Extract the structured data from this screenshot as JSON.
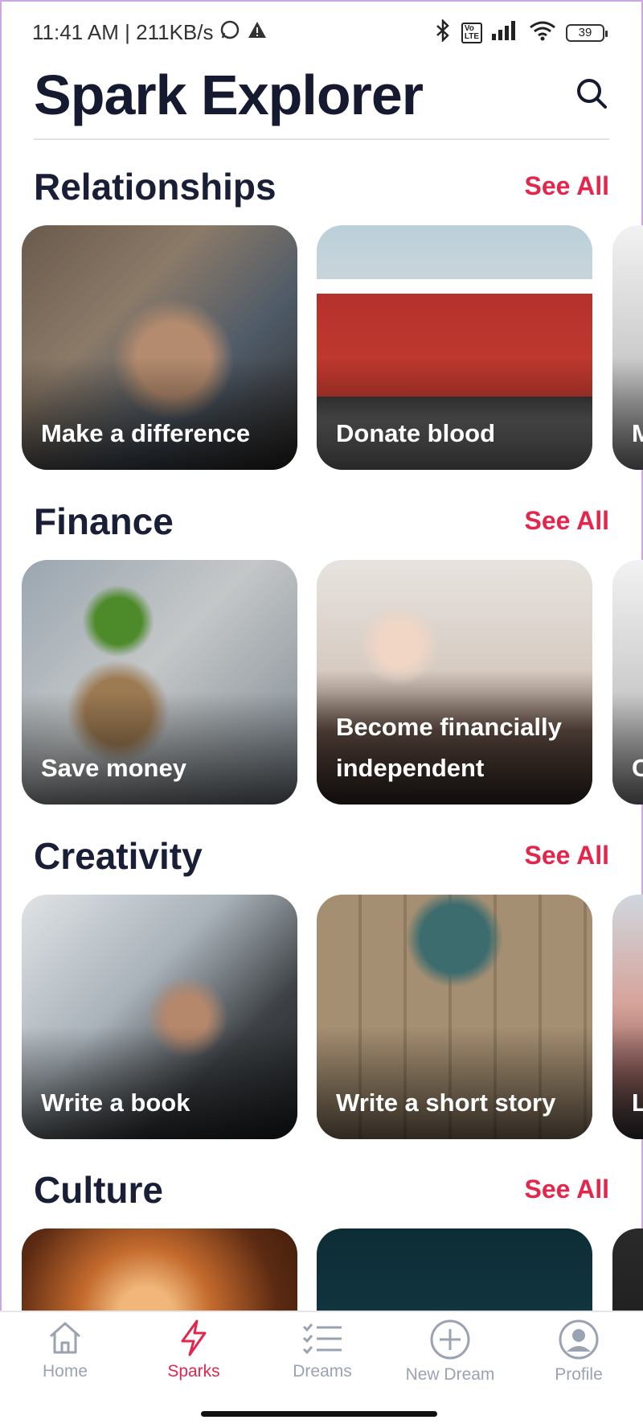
{
  "status_bar": {
    "time_speed": "11:41 AM | 211KB/s",
    "battery": "39"
  },
  "header": {
    "title": "Spark Explorer"
  },
  "sections": [
    {
      "title": "Relationships",
      "see_all": "See All",
      "cards": [
        {
          "label": "Make a difference",
          "image": "hands-high-five"
        },
        {
          "label": "Donate blood",
          "image": "red-bus"
        },
        {
          "label": "M",
          "image": "partial"
        }
      ]
    },
    {
      "title": "Finance",
      "see_all": "See All",
      "cards": [
        {
          "label": "Save money",
          "image": "coin-jar-plant"
        },
        {
          "label": "Become financially independent",
          "image": "girl-at-sea"
        },
        {
          "label": "C",
          "image": "partial"
        }
      ]
    },
    {
      "title": "Creativity",
      "see_all": "See All",
      "cards": [
        {
          "label": "Write a book",
          "image": "laptop-typing"
        },
        {
          "label": "Write a short story",
          "image": "typewriter"
        },
        {
          "label": "L",
          "image": "partial"
        }
      ]
    },
    {
      "title": "Culture",
      "see_all": "See All",
      "cards": [
        {
          "label": "",
          "image": "fire"
        },
        {
          "label": "",
          "image": "theater"
        },
        {
          "label": "",
          "image": "partial"
        }
      ]
    }
  ],
  "nav": {
    "items": [
      {
        "label": "Home",
        "icon": "home-icon",
        "active": false
      },
      {
        "label": "Sparks",
        "icon": "lightning-icon",
        "active": true
      },
      {
        "label": "Dreams",
        "icon": "list-check-icon",
        "active": false
      },
      {
        "label": "New Dream",
        "icon": "plus-circle-icon",
        "active": false
      },
      {
        "label": "Profile",
        "icon": "user-icon",
        "active": false
      }
    ]
  },
  "colors": {
    "accent": "#e3264b",
    "title": "#151a31",
    "nav_inactive": "#9aa3b2"
  }
}
